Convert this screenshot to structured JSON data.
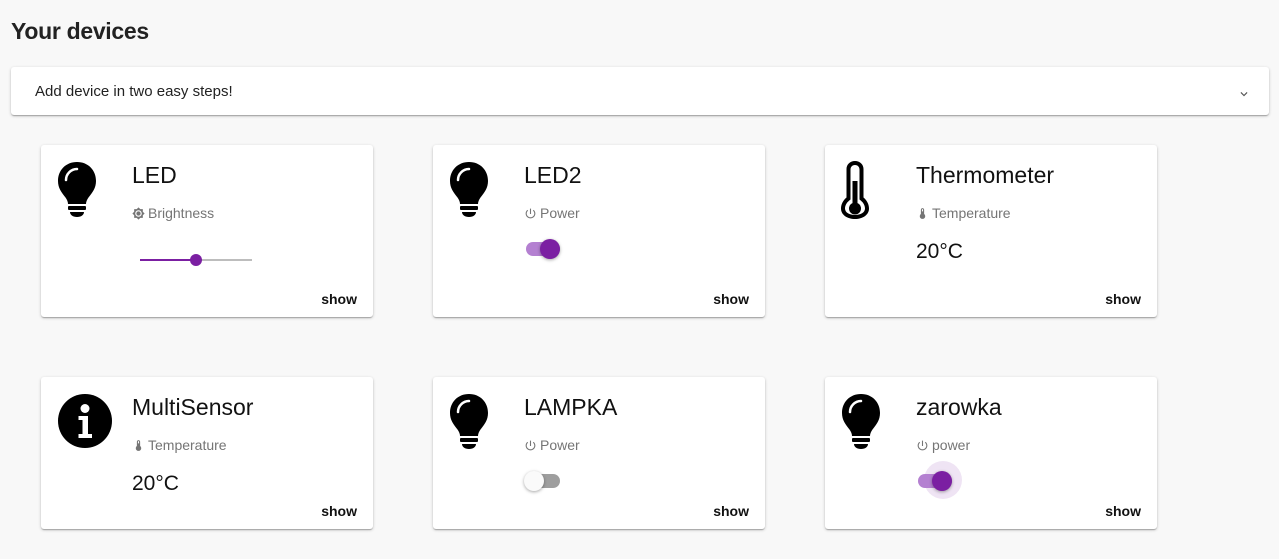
{
  "page": {
    "title": "Your devices"
  },
  "add_device": {
    "label": "Add device in two easy steps!",
    "icon": "chevron-down-icon"
  },
  "colors": {
    "accent": "#7b1fa2",
    "accent_light": "#b480d1"
  },
  "devices": [
    {
      "name": "LED",
      "icon": "lightbulb-icon",
      "property": "Brightness",
      "property_icon": "brightness-icon",
      "control": "slider",
      "slider_value": 0.5,
      "action": "show"
    },
    {
      "name": "LED2",
      "icon": "lightbulb-icon",
      "property": "Power",
      "property_icon": "power-icon",
      "control": "toggle",
      "toggle_on": true,
      "action": "show"
    },
    {
      "name": "Thermometer",
      "icon": "thermometer-icon",
      "property": "Temperature",
      "property_icon": "thermometer-icon",
      "control": "value",
      "value": "20°C",
      "action": "show"
    },
    {
      "name": "MultiSensor",
      "icon": "info-icon",
      "property": "Temperature",
      "property_icon": "thermometer-icon",
      "control": "value",
      "value": "20°C",
      "action": "show"
    },
    {
      "name": "LAMPKA",
      "icon": "lightbulb-icon",
      "property": "Power",
      "property_icon": "power-icon",
      "control": "toggle",
      "toggle_on": false,
      "action": "show"
    },
    {
      "name": "zarowka",
      "icon": "lightbulb-icon",
      "property": "power",
      "property_icon": "power-icon",
      "control": "toggle",
      "toggle_on": true,
      "toggle_focused": true,
      "action": "show"
    }
  ]
}
